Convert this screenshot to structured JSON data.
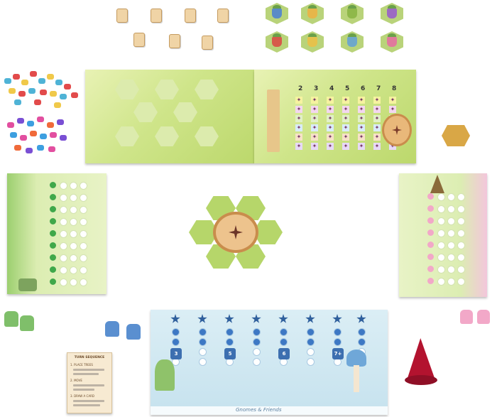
{
  "scene": {
    "main_board_columns": [
      "2",
      "3",
      "4",
      "5",
      "6",
      "7",
      "8"
    ],
    "blue_board_values": [
      "3",
      "5",
      "6",
      "7+"
    ],
    "reference_card_title": "TURN SEQUENCE",
    "reference_card_steps": [
      "1. PLACE TREES",
      "2. MOVE",
      "3. DRAW A CARD"
    ],
    "blue_board_banner": "Gnomes & Friends"
  },
  "colors": {
    "grass": "#cfe58a",
    "stump": "#e9b87a",
    "blue_board": "#c6e2ee",
    "pink_board": "#f3c6dc",
    "gnome_hat_red": "#b3132f",
    "gnome_hat_blue": "#4f8fd8",
    "mushroom_pink": "#e76aa4"
  },
  "icons": [
    "flower-token-icon",
    "gnome-meeple-icon",
    "mushroom-icon",
    "stump-icon",
    "pinwheel-icon"
  ]
}
